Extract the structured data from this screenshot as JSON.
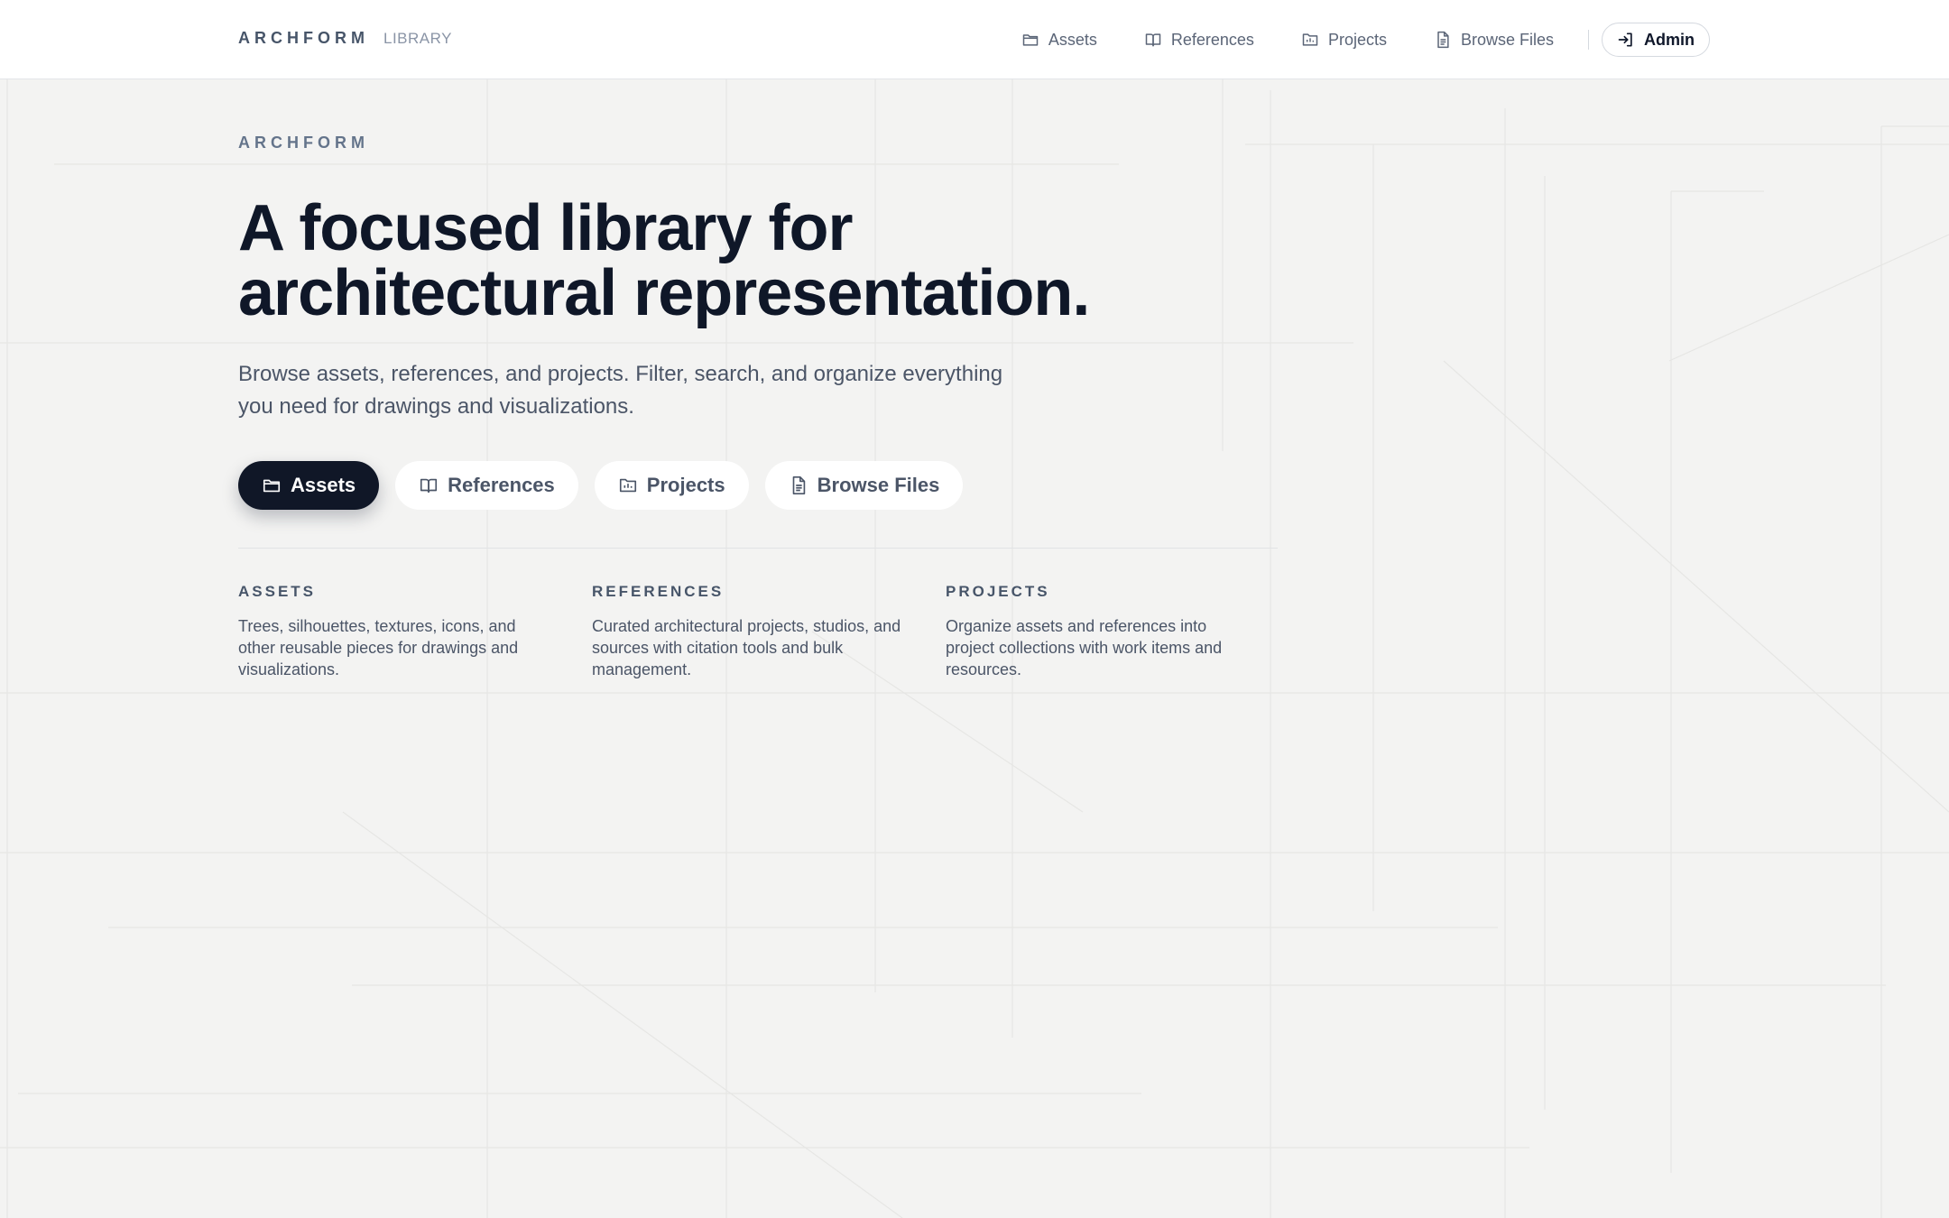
{
  "header": {
    "brand": "ARCHFORM",
    "brand_sub": "LIBRARY",
    "nav": [
      {
        "label": "Assets",
        "icon": "folder-icon"
      },
      {
        "label": "References",
        "icon": "book-icon"
      },
      {
        "label": "Projects",
        "icon": "project-folder-icon"
      },
      {
        "label": "Browse Files",
        "icon": "file-text-icon"
      }
    ],
    "admin_label": "Admin",
    "admin_icon": "sign-in-icon"
  },
  "hero": {
    "eyebrow": "ARCHFORM",
    "headline_line1": "A focused library for",
    "headline_line2": "architectural representation.",
    "lead": "Browse assets, references, and projects. Filter, search, and organize everything you need for drawings and visualizations.",
    "pills": [
      {
        "label": "Assets",
        "icon": "folder-icon",
        "active": true
      },
      {
        "label": "References",
        "icon": "book-icon",
        "active": false
      },
      {
        "label": "Projects",
        "icon": "project-folder-icon",
        "active": false
      },
      {
        "label": "Browse Files",
        "icon": "file-text-icon",
        "active": false
      }
    ]
  },
  "features": [
    {
      "title": "ASSETS",
      "desc": "Trees, silhouettes, textures, icons, and other reusable pieces for drawings and visualizations."
    },
    {
      "title": "REFERENCES",
      "desc": "Curated architectural projects, studios, and sources with citation tools and bulk management."
    },
    {
      "title": "PROJECTS",
      "desc": "Organize assets and references into project collections with work items and resources."
    }
  ],
  "colors": {
    "background": "#f3f3f2",
    "header_bg": "#ffffff",
    "primary_dark": "#101727",
    "text_muted": "#4b5567"
  }
}
